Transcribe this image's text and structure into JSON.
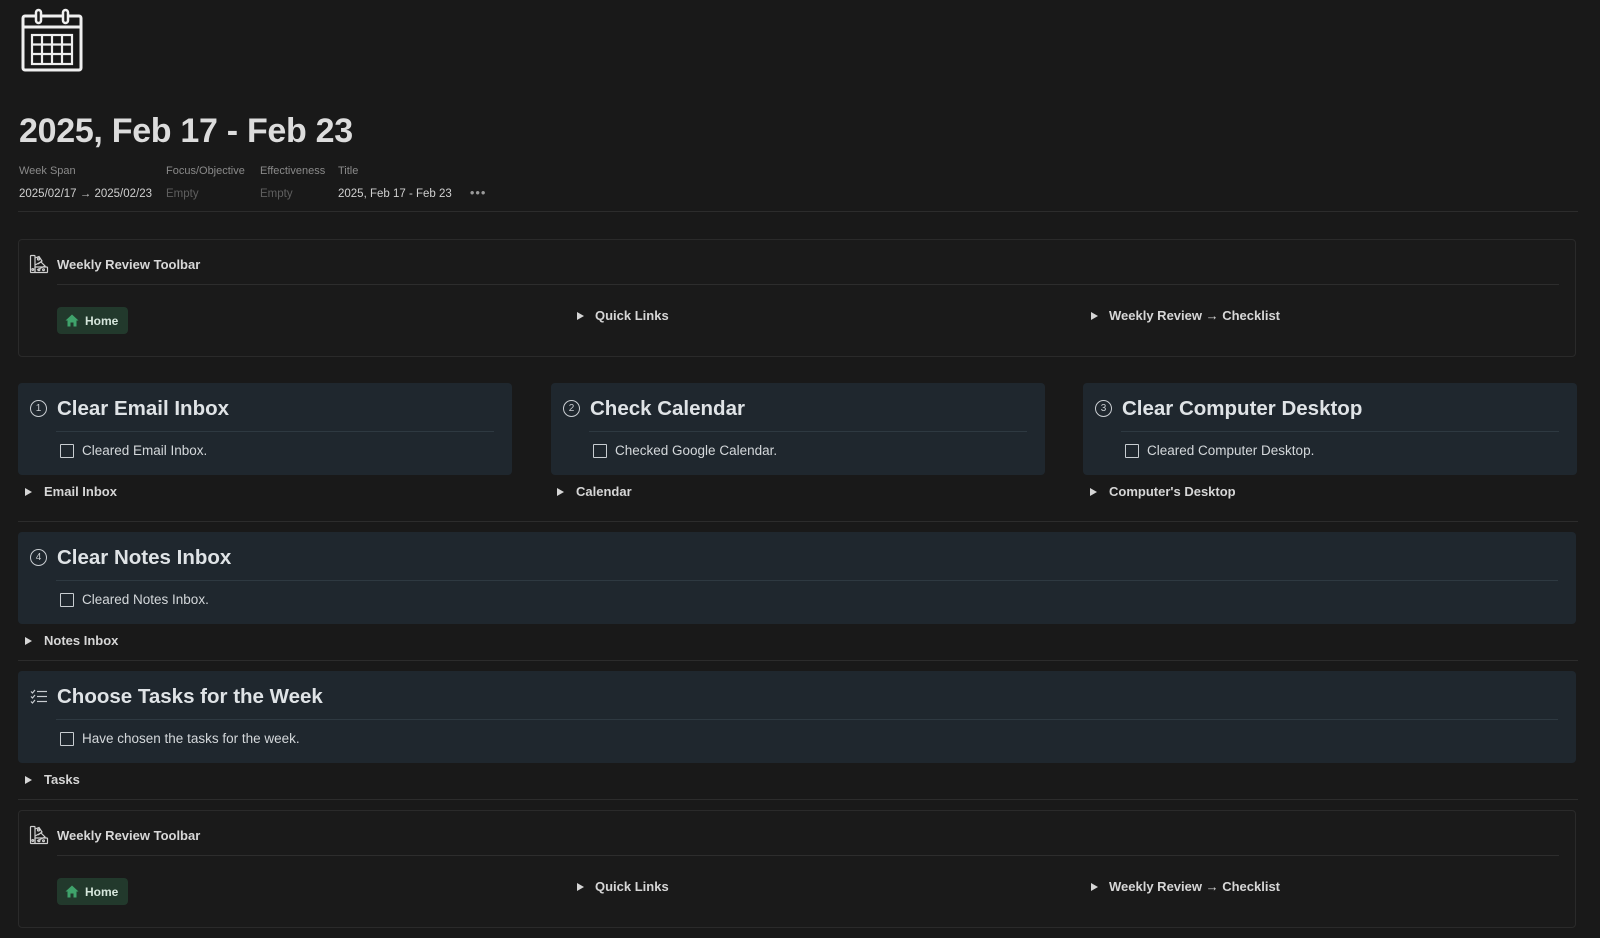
{
  "page": {
    "icon": "calendar-icon",
    "title": "2025, Feb 17 - Feb 23"
  },
  "properties": [
    {
      "label": "Week Span",
      "value": "2025/02/17 → 2025/02/23",
      "empty": false
    },
    {
      "label": "Focus/Objective",
      "value": "Empty",
      "empty": true
    },
    {
      "label": "Effectiveness",
      "value": "Empty",
      "empty": true
    },
    {
      "label": "Title",
      "value": "2025, Feb 17 - Feb 23",
      "empty": false
    }
  ],
  "more_label": "•••",
  "toolbar_top": {
    "icon": "swatches-icon",
    "title": "Weekly Review Toolbar",
    "home_label": "Home",
    "quick_links_label": "Quick Links",
    "checklist_label": "Weekly Review → Checklist"
  },
  "toolbar_bottom": {
    "icon": "swatches-icon",
    "title": "Weekly Review Toolbar",
    "home_label": "Home",
    "quick_links_label": "Quick Links",
    "checklist_label": "Weekly Review → Checklist"
  },
  "steps": [
    {
      "number": "1",
      "title": "Clear Email Inbox",
      "checkbox_label": "Cleared Email Inbox.",
      "checked": false,
      "toggle_label": "Email Inbox"
    },
    {
      "number": "2",
      "title": "Check Calendar",
      "checkbox_label": "Checked Google Calendar.",
      "checked": false,
      "toggle_label": "Calendar"
    },
    {
      "number": "3",
      "title": "Clear Computer Desktop",
      "checkbox_label": "Cleared Computer Desktop.",
      "checked": false,
      "toggle_label": "Computer's Desktop"
    },
    {
      "number": "4",
      "title": "Clear Notes Inbox",
      "checkbox_label": "Cleared Notes Inbox.",
      "checked": false,
      "toggle_label": "Notes Inbox"
    },
    {
      "icon": "checklist-icon",
      "title": "Choose Tasks for the Week",
      "checkbox_label": "Have chosen the tasks for the week.",
      "checked": false,
      "toggle_label": "Tasks"
    }
  ],
  "colors": {
    "background": "#191919",
    "callout_bg": "#1f272e",
    "home_button_bg": "#22392c",
    "home_icon": "#3fa36b"
  }
}
